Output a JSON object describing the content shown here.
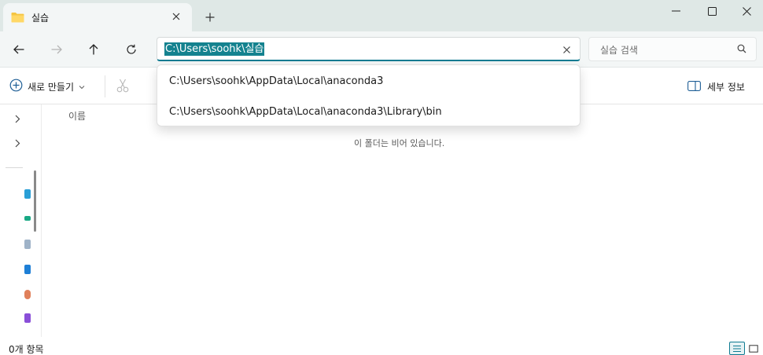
{
  "tab": {
    "title": "실습"
  },
  "address": {
    "path": "C:\\Users\\soohk\\실습",
    "suggestions": [
      "C:\\Users\\soohk\\AppData\\Local\\anaconda3",
      "C:\\Users\\soohk\\AppData\\Local\\anaconda3\\Library\\bin"
    ]
  },
  "search": {
    "placeholder": "실습 검색"
  },
  "commandbar": {
    "new_label": "새로 만들기",
    "details_label": "세부 정보"
  },
  "content": {
    "column_name": "이름",
    "empty_message": "이 폴더는 비어 있습니다."
  },
  "status": {
    "item_count": "0개 항목"
  },
  "colors": {
    "accent": "#0f7b92",
    "selection": "#14828f",
    "folder": "#f5c542",
    "titlebar": "#dfe8e6"
  },
  "icons": [
    "folder-icon",
    "close-icon",
    "plus-icon",
    "minimize-icon",
    "maximize-icon",
    "back-arrow-icon",
    "forward-arrow-icon",
    "up-arrow-icon",
    "refresh-icon",
    "search-icon",
    "plus-circle-icon",
    "chevron-down-icon",
    "scissors-icon",
    "details-pane-icon",
    "chevron-right-icon",
    "details-view-icon",
    "tiles-view-icon"
  ]
}
